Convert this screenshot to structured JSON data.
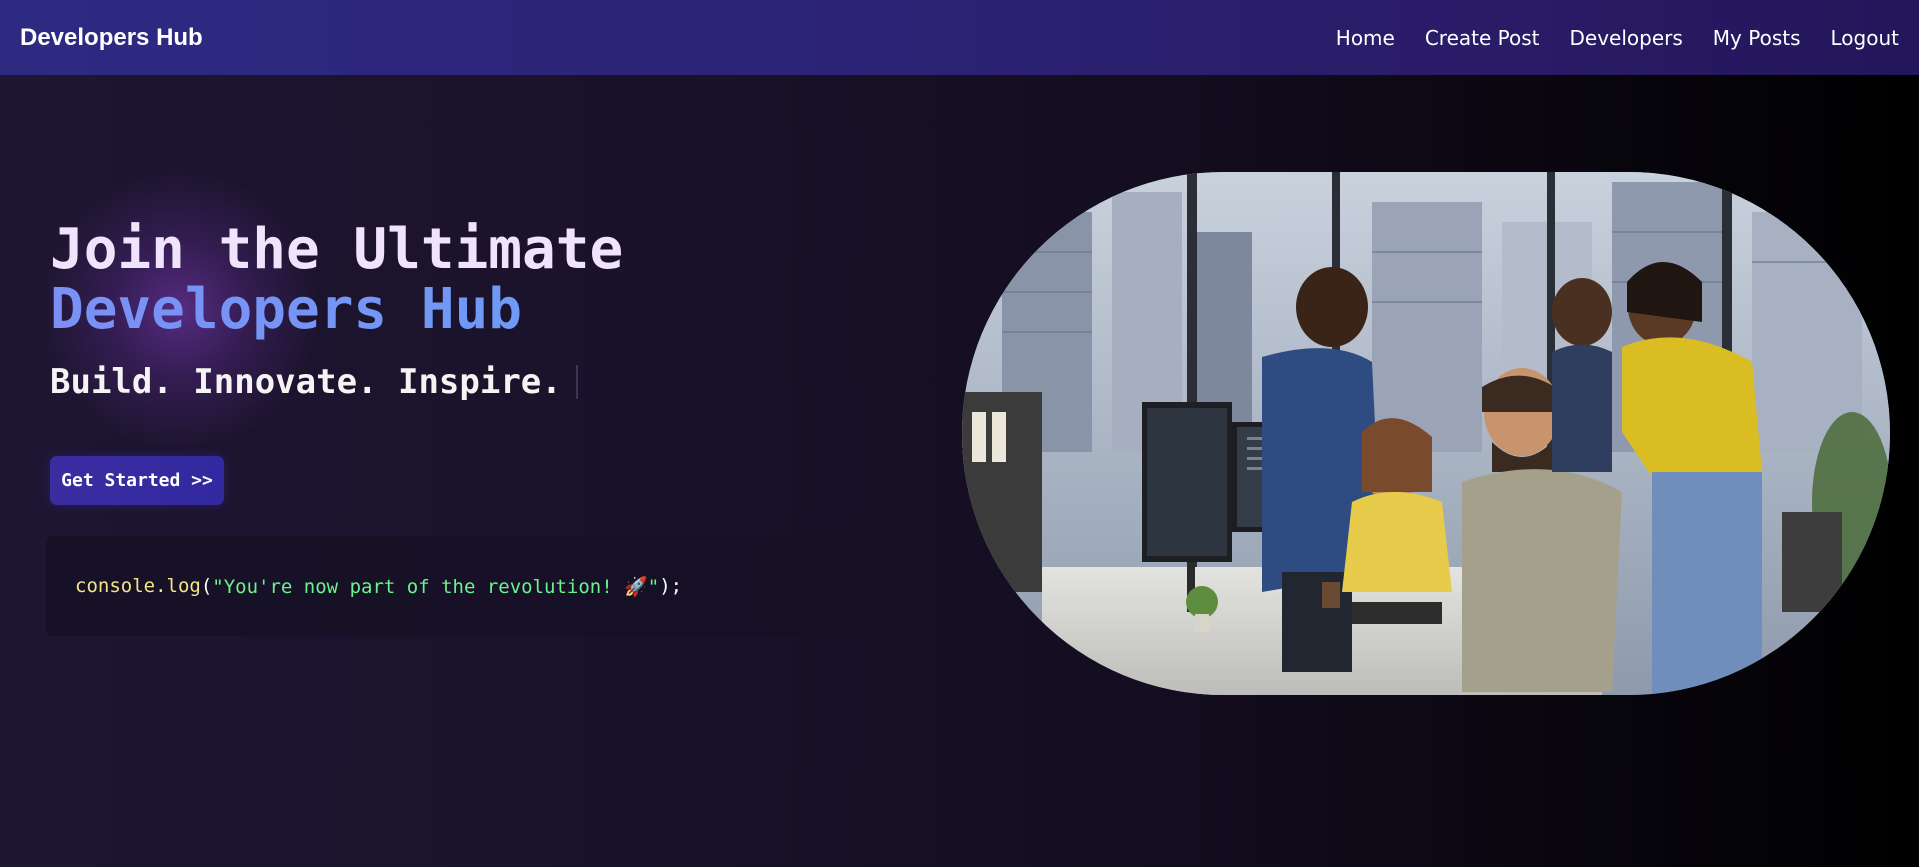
{
  "navbar": {
    "brand": "Developers Hub",
    "links": [
      {
        "label": "Home"
      },
      {
        "label": "Create Post"
      },
      {
        "label": "Developers"
      },
      {
        "label": "My Posts"
      },
      {
        "label": "Logout"
      }
    ]
  },
  "hero": {
    "title_line1": "Join the Ultimate",
    "title_line2": "Developers Hub",
    "tagline": "Build. Innovate. Inspire.",
    "cta_label": "Get Started >>",
    "code": {
      "fn": "console.log",
      "open": "(",
      "string": "\"You're now part of the revolution! 🚀\"",
      "close": ");"
    },
    "image_alt": "Team of developers collaborating around computer monitors in a modern office"
  },
  "colors": {
    "accent": "#3a2da0",
    "navbar": "#2d2a82",
    "title_gradient": "#6e9cf5",
    "code_string": "#6cf28f",
    "code_fn": "#f4e48a"
  }
}
